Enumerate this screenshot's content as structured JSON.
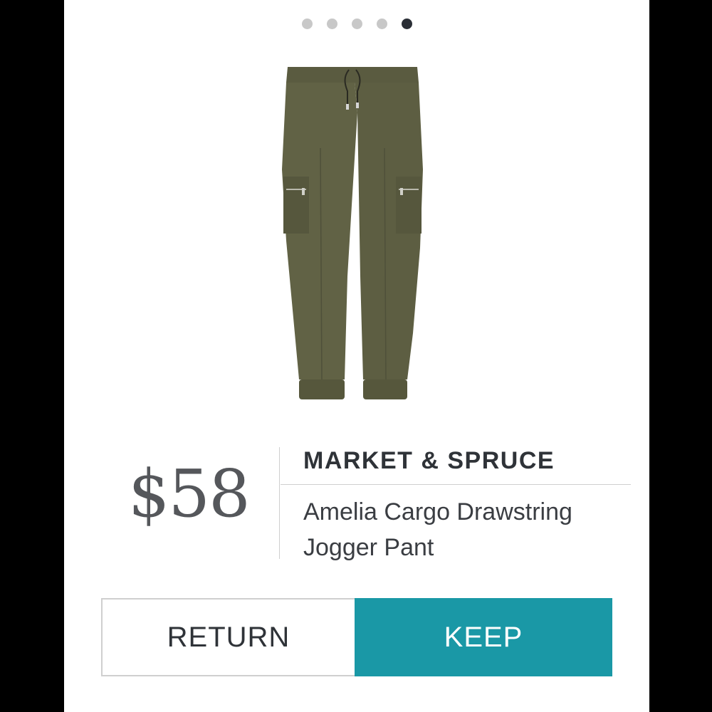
{
  "carousel": {
    "slides": 5,
    "active_index": 4
  },
  "product": {
    "price": "$58",
    "brand": "MARKET & SPRUCE",
    "name": "Amelia Cargo Drawstring Jogger Pant",
    "image_icon": "olive-jogger-pant-image"
  },
  "actions": {
    "return_label": "RETURN",
    "keep_label": "KEEP"
  },
  "colors": {
    "pant": "#5f6045",
    "keep_button": "#1a98a6",
    "price_text": "#55575b",
    "dot_inactive": "#c8c8c8",
    "dot_active": "#2b2f36"
  }
}
